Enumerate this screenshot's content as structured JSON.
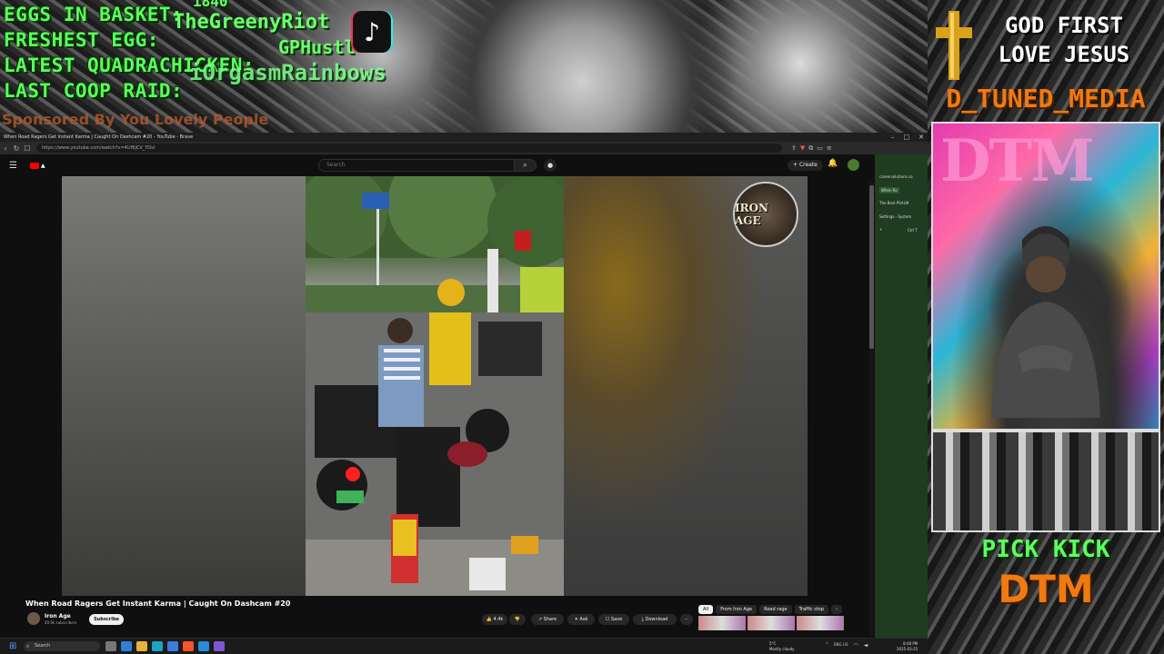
{
  "overlay": {
    "stats": [
      "EGGS IN BASKET:",
      "FRESHEST EGG:",
      "LATEST QUADRACHICKEN:",
      "LAST COOP RAID:"
    ],
    "nicks": [
      "1840",
      "TheGreenyRiot",
      "GPHustl",
      "iOrgasmRainbows"
    ],
    "sponsor": "Sponsored By You Lovely People",
    "right_line1": "GOD FIRST",
    "right_line2": "LOVE JESUS",
    "channel": "D_TUNED_MEDIA",
    "webcam_sign": "DTM",
    "pick_kick": "PICK KICK",
    "pick_dtm": "DTM"
  },
  "browser": {
    "tab_title": "When Road Ragers Get Instant Karma | Caught On Dashcam #20 - YouTube - Brave",
    "url": "https://www.youtube.com/watch?v=4Uf6jCV_YDsI"
  },
  "youtube": {
    "search_placeholder": "Search",
    "create_label": "Create",
    "video_title": "When Road Ragers Get Instant Karma | Caught On Dashcam #20",
    "channel_name": "Iron Age",
    "subscribers": "40.9k subscribers",
    "subscribe_label": "Subscribe",
    "badge_text": "IRON AGE",
    "likes": "4.4k",
    "share_label": "Share",
    "ask_label": "Ask",
    "save_label": "Save",
    "download_label": "Download",
    "chips": [
      "All",
      "From Iron Age",
      "Road rage",
      "Traffic stop"
    ]
  },
  "sidebar": {
    "items": [
      "careersolutions.co",
      "When Ro",
      "The Best PSALM",
      "Settings - System",
      "Ctrl T"
    ]
  },
  "taskbar": {
    "search_placeholder": "Search",
    "weather_temp": "5°C",
    "weather_desc": "Mostly cloudy",
    "time": "8:48 PM",
    "date": "2025-03-25",
    "lang": "ENG US"
  },
  "colors": {
    "green": "#5cff5c",
    "orange": "#f07a10",
    "yt_red": "#ff0000",
    "sidebar_bg": "#1f3b21"
  }
}
